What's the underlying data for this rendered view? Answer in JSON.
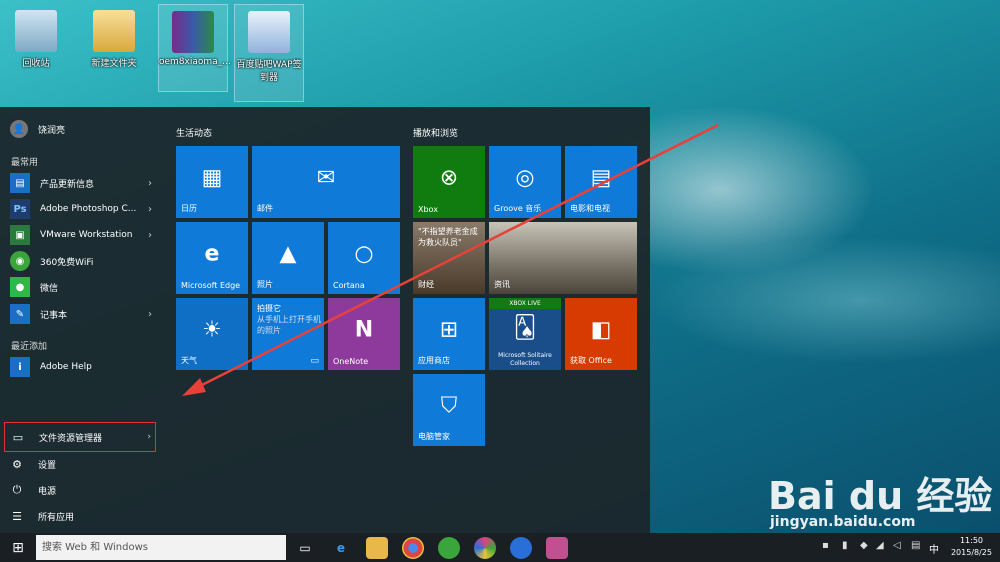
{
  "desktop": {
    "icons": [
      {
        "label": "回收站"
      },
      {
        "label": "新建文件夹"
      },
      {
        "label": "oem8xiaoma_..."
      },
      {
        "label": "百度贴吧WAP签到器"
      }
    ]
  },
  "start_menu": {
    "user_name": "饶润亮",
    "most_used_label": "最常用",
    "most_used": [
      {
        "label": "产品更新信息",
        "icon": "document-icon",
        "color": "#1a6fc4"
      },
      {
        "label": "Adobe Photoshop C...",
        "icon": "photoshop-icon",
        "color": "#1e3c6e"
      },
      {
        "label": "VMware Workstation",
        "icon": "vmware-icon",
        "color": "#2b7a3d"
      },
      {
        "label": "360免费WiFi",
        "icon": "wifi-icon",
        "color": "#3aa53a"
      },
      {
        "label": "微信",
        "icon": "wechat-icon",
        "color": "#2eb84a"
      },
      {
        "label": "记事本",
        "icon": "notepad-icon",
        "color": "#1a6fc4"
      }
    ],
    "recent_label": "最近添加",
    "recent": [
      {
        "label": "Adobe Help",
        "icon": "info-icon",
        "color": "#1a6fc4"
      }
    ],
    "bottom": [
      {
        "label": "文件资源管理器",
        "icon": "folder-icon"
      },
      {
        "label": "设置",
        "icon": "gear-icon"
      },
      {
        "label": "电源",
        "icon": "power-icon"
      },
      {
        "label": "所有应用",
        "icon": "list-icon"
      }
    ],
    "group_life": "生活动态",
    "group_play": "播放和浏览",
    "tiles_life": [
      {
        "label": "日历",
        "icon": "calendar-icon",
        "color": "#0f7ad8"
      },
      {
        "label": "邮件",
        "icon": "mail-icon",
        "color": "#0f7ad8"
      },
      {
        "label": "Microsoft Edge",
        "icon": "edge-icon",
        "color": "#0f7ad8"
      },
      {
        "label": "照片",
        "icon": "photo-icon",
        "color": "#0f7ad8"
      },
      {
        "label": "Cortana",
        "icon": "cortana-icon",
        "color": "#0f7ad8"
      },
      {
        "label": "天气",
        "icon": "sun-icon",
        "color": "#0f7ad8"
      },
      {
        "label": "拍摄它",
        "sub": "从手机上打开手机的照片",
        "icon": "camera-icon",
        "color": "#0f7ad8"
      },
      {
        "label": "OneNote",
        "icon": "onenote-icon",
        "color": "#8e3a9c"
      }
    ],
    "tiles_play": [
      {
        "label": "Xbox",
        "icon": "xbox-icon",
        "color": "#107c10"
      },
      {
        "label": "Groove 音乐",
        "icon": "groove-icon",
        "color": "#0f7ad8"
      },
      {
        "label": "电影和电视",
        "icon": "movie-icon",
        "color": "#0f7ad8"
      },
      {
        "label": "财经",
        "headline": "\"不指望养老金成为救火队员\"",
        "icon": "finance-icon",
        "color": "#5a4a3a"
      },
      {
        "label": "资讯",
        "icon": "news-icon",
        "color": "#6a6a6a"
      },
      {
        "label": "应用商店",
        "icon": "store-icon",
        "color": "#0f7ad8"
      },
      {
        "label": "Microsoft Solitaire Collection",
        "badge": "XBOX LIVE",
        "icon": "cards-icon",
        "color": "#1a4e8a"
      },
      {
        "label": "获取 Office",
        "icon": "office-icon",
        "color": "#d83b01"
      },
      {
        "label": "电脑管家",
        "icon": "shield-icon",
        "color": "#0f7ad8"
      }
    ]
  },
  "taskbar": {
    "search_placeholder": "搜索 Web 和 Windows",
    "apps": [
      {
        "icon": "task-view-icon",
        "color": "#1a1f24"
      },
      {
        "icon": "edge-icon",
        "color": "#1a1f24"
      },
      {
        "icon": "folder-icon",
        "color": "#e8b84a"
      },
      {
        "icon": "chrome-icon",
        "color": "#d44"
      },
      {
        "icon": "360-icon",
        "color": "#3aa53a"
      },
      {
        "icon": "flower-icon",
        "color": "#e04080"
      },
      {
        "icon": "sogou-icon",
        "color": "#2a6fd8"
      },
      {
        "icon": "people-icon",
        "color": "#c05090"
      }
    ],
    "lang": "中",
    "time": "11:50",
    "date": "2015/8/25"
  },
  "watermark": {
    "logo": "Bai du 经验",
    "url": "jingyan.baidu.com"
  }
}
